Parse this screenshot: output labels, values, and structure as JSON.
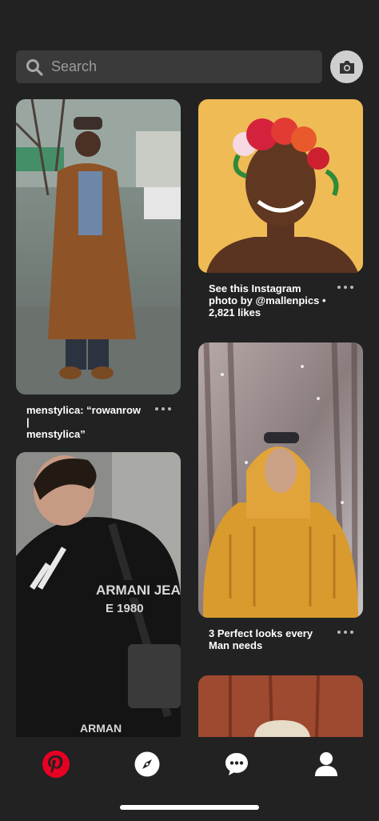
{
  "search": {
    "placeholder": "Search"
  },
  "pins": [
    {
      "caption_line1": "menstylica: “rowanrow |",
      "caption_line2": "menstylica”"
    },
    {
      "caption_line1": "See this Instagram",
      "caption_line2": "photo by @mallenpics •",
      "caption_line3": "2,821 likes"
    },
    {
      "caption_line1": "3 Perfect looks every",
      "caption_line2": "Man needs"
    },
    {
      "caption_line1": ""
    },
    {
      "caption_line1": ""
    }
  ],
  "tabs": [
    {
      "name": "home",
      "icon": "pinterest-logo-icon",
      "active": true
    },
    {
      "name": "explore",
      "icon": "compass-icon"
    },
    {
      "name": "messages",
      "icon": "chat-bubble-icon"
    },
    {
      "name": "profile",
      "icon": "user-icon"
    }
  ],
  "colors": {
    "background": "#222222",
    "search_bg": "#3a3a3a",
    "brand": "#e60023"
  }
}
